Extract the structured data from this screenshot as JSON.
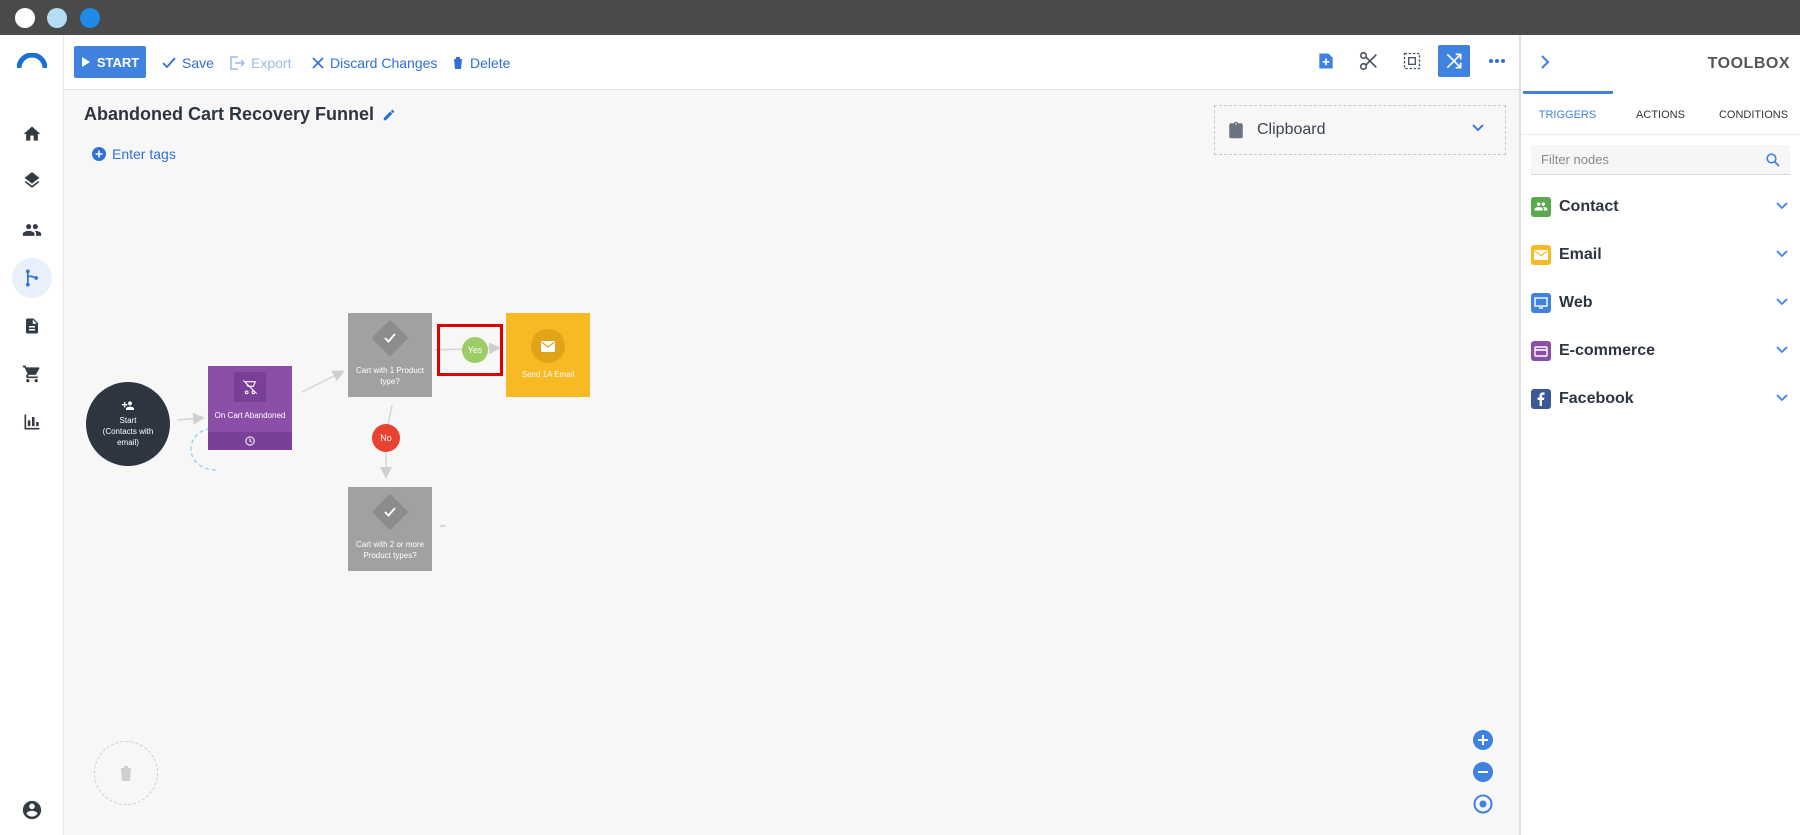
{
  "window": {
    "dots": [
      "#ffffff",
      "#b5dcf5",
      "#1c8ae6"
    ]
  },
  "nav": {
    "items": [
      {
        "name": "home-icon"
      },
      {
        "name": "layers-icon"
      },
      {
        "name": "contacts-icon"
      },
      {
        "name": "workflow-icon",
        "active": true
      },
      {
        "name": "document-icon"
      },
      {
        "name": "cart-icon"
      },
      {
        "name": "analytics-icon"
      }
    ],
    "bottom": {
      "name": "account-icon"
    }
  },
  "toolbar": {
    "start_label": "START",
    "save_label": "Save",
    "export_label": "Export",
    "discard_label": "Discard Changes",
    "delete_label": "Delete",
    "right_icons": [
      "add-note-icon",
      "cut-icon",
      "select-all-icon",
      "shuffle-icon",
      "more-icon"
    ]
  },
  "canvas": {
    "title": "Abandoned Cart Recovery Funnel",
    "tags_label": "Enter tags",
    "clipboard_label": "Clipboard",
    "nodes": {
      "start": "Start\n(Contacts with\nemail)",
      "trigger": "On Cart Abandoned",
      "condition1": "Cart with 1 Product\ntype?",
      "condition2": "Cart with 2 or more\nProduct types?",
      "email": "Send 1A Email",
      "yes": "Yes",
      "no": "No"
    },
    "colors": {
      "start": "#2e3540",
      "trigger": "#8c4fa8",
      "condition": "#a1a1a1",
      "email": "#f7b924",
      "yes": "#9ccc65",
      "no": "#e84330",
      "highlight": "#e00000"
    }
  },
  "toolbox": {
    "title": "TOOLBOX",
    "tabs": [
      "TRIGGERS",
      "ACTIONS",
      "CONDITIONS"
    ],
    "active_tab": "TRIGGERS",
    "filter_placeholder": "Filter nodes",
    "categories": [
      {
        "label": "Contact",
        "icon": "contact-icon",
        "color": "#5aa94f"
      },
      {
        "label": "Email",
        "icon": "email-icon",
        "color": "#f7b924"
      },
      {
        "label": "Web",
        "icon": "web-icon",
        "color": "#3f82e0"
      },
      {
        "label": "E-commerce",
        "icon": "ecommerce-icon",
        "color": "#8c4fa8"
      },
      {
        "label": "Facebook",
        "icon": "facebook-icon",
        "color": "#3b5998"
      }
    ]
  }
}
